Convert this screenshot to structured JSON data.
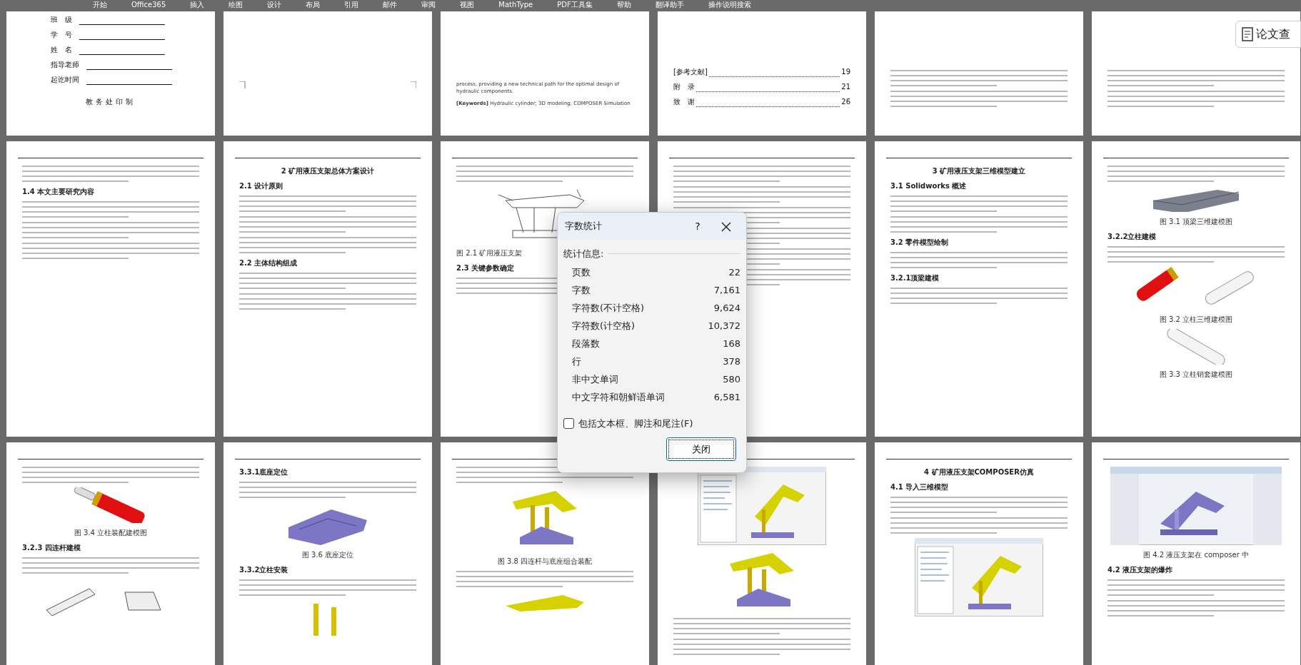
{
  "ribbon": {
    "tabs": [
      "开始",
      "Office365",
      "插入",
      "绘图",
      "设计",
      "布局",
      "引用",
      "邮件",
      "审阅",
      "视图",
      "MathType",
      "PDF工具集",
      "帮助",
      "翻译助手"
    ],
    "search": "操作说明搜索"
  },
  "side_button": {
    "label": "论文查"
  },
  "pages": [
    {
      "blocks": [
        {
          "kind": "field",
          "text": "班　级"
        },
        {
          "kind": "field",
          "text": "学　号"
        },
        {
          "kind": "field",
          "text": "姓　名"
        },
        {
          "kind": "field",
          "text": "指导老师"
        },
        {
          "kind": "field",
          "text": "起讫时间"
        },
        {
          "kind": "note",
          "text": "教务处印制"
        }
      ]
    },
    {
      "blocks": [
        {
          "kind": "corner-marks"
        }
      ]
    },
    {
      "blocks": [
        {
          "kind": "english",
          "text": "process, providing a new technical path for the optimal design of hydraulic components."
        },
        {
          "kind": "english",
          "text": "**[Keywords]** Hydraulic cylinder; 3D modeling; COMPOSER Simulation"
        }
      ]
    },
    {
      "blocks": [
        {
          "kind": "toc",
          "text": "[参考文献]",
          "page": "19"
        },
        {
          "kind": "toc",
          "text": "附　录",
          "page": "21"
        },
        {
          "kind": "toc",
          "text": "致　谢",
          "page": "26"
        }
      ]
    },
    {
      "blocks": [
        {
          "kind": "lines"
        },
        {
          "kind": "lines"
        }
      ]
    },
    {
      "blocks": [
        {
          "kind": "lines"
        },
        {
          "kind": "lines"
        }
      ]
    },
    {
      "blocks": [
        {
          "kind": "lines"
        },
        {
          "kind": "heading",
          "text": "1.4 本文主要研究内容"
        },
        {
          "kind": "lines"
        },
        {
          "kind": "lines"
        },
        {
          "kind": "lines"
        }
      ]
    },
    {
      "blocks": [
        {
          "kind": "title",
          "text": "2 矿用液压支架总体方案设计"
        },
        {
          "kind": "heading",
          "text": "2.1 设计原则"
        },
        {
          "kind": "lines"
        },
        {
          "kind": "lines"
        },
        {
          "kind": "lines"
        },
        {
          "kind": "heading",
          "text": "2.2 主体结构组成"
        },
        {
          "kind": "lines"
        },
        {
          "kind": "lines"
        }
      ]
    },
    {
      "blocks": [
        {
          "kind": "lines"
        },
        {
          "kind": "frame"
        },
        {
          "kind": "caption-left",
          "text": "图 2.1 矿用液压支架"
        },
        {
          "kind": "heading",
          "text": "2.3 关键参数确定"
        },
        {
          "kind": "lines"
        }
      ]
    },
    {
      "blocks": [
        {
          "kind": "lines"
        },
        {
          "kind": "lines"
        },
        {
          "kind": "lines"
        },
        {
          "kind": "lines"
        },
        {
          "kind": "lines"
        },
        {
          "kind": "lines"
        }
      ]
    },
    {
      "blocks": [
        {
          "kind": "title",
          "text": "3 矿用液压支架三维模型建立"
        },
        {
          "kind": "heading",
          "text": "3.1 Solidworks 概述"
        },
        {
          "kind": "lines"
        },
        {
          "kind": "lines"
        },
        {
          "kind": "heading",
          "text": "3.2 零件模型绘制"
        },
        {
          "kind": "lines"
        },
        {
          "kind": "heading",
          "text": "3.2.1顶梁建模"
        },
        {
          "kind": "lines"
        }
      ]
    },
    {
      "blocks": [
        {
          "kind": "lines"
        },
        {
          "kind": "plate"
        },
        {
          "kind": "caption",
          "text": "图 3.1 顶梁三维建模图"
        },
        {
          "kind": "heading",
          "text": "3.2.2立柱建模"
        },
        {
          "kind": "lines"
        },
        {
          "kind": "cylinders"
        },
        {
          "kind": "caption",
          "text": "图 3.2 立柱三维建模图"
        },
        {
          "kind": "pin"
        },
        {
          "kind": "caption",
          "text": "图 3.3 立柱销套建模图"
        }
      ]
    },
    {
      "blocks": [
        {
          "kind": "lines"
        },
        {
          "kind": "redcylinder"
        },
        {
          "kind": "caption",
          "text": "图 3.4 立柱装配建模图"
        },
        {
          "kind": "heading",
          "text": "3.2.3 四连杆建模"
        },
        {
          "kind": "lines"
        },
        {
          "kind": "linkage"
        }
      ]
    },
    {
      "blocks": [
        {
          "kind": "heading",
          "text": "3.3.1底座定位"
        },
        {
          "kind": "lines"
        },
        {
          "kind": "base"
        },
        {
          "kind": "caption",
          "text": "图 3.6 底座定位"
        },
        {
          "kind": "heading",
          "text": "3.3.2立柱安装"
        },
        {
          "kind": "lines"
        },
        {
          "kind": "posts"
        }
      ]
    },
    {
      "blocks": [
        {
          "kind": "lines"
        },
        {
          "kind": "support"
        },
        {
          "kind": "caption",
          "text": "图 3.8 四连杆与底座组合装配"
        },
        {
          "kind": "lines"
        },
        {
          "kind": "canopy"
        }
      ]
    },
    {
      "blocks": [
        {
          "kind": "screenshot"
        },
        {
          "kind": "support"
        },
        {
          "kind": "lines"
        },
        {
          "kind": "lines"
        }
      ]
    },
    {
      "blocks": [
        {
          "kind": "title",
          "text": "4 矿用液压支架COMPOSER仿真"
        },
        {
          "kind": "heading",
          "text": "4.1 导入三维模型"
        },
        {
          "kind": "lines"
        },
        {
          "kind": "lines"
        },
        {
          "kind": "screenshot"
        }
      ]
    },
    {
      "blocks": [
        {
          "kind": "viewer"
        },
        {
          "kind": "caption",
          "text": "图 4.2 液压支架在 composer 中"
        },
        {
          "kind": "heading",
          "text": "4.2 液压支架的爆炸"
        },
        {
          "kind": "lines"
        },
        {
          "kind": "lines"
        }
      ]
    }
  ],
  "dialog": {
    "title": "字数统计",
    "help": "?",
    "section": "统计信息:",
    "stats": [
      {
        "label": "页数",
        "value": "22"
      },
      {
        "label": "字数",
        "value": "7,161"
      },
      {
        "label": "字符数(不计空格)",
        "value": "9,624"
      },
      {
        "label": "字符数(计空格)",
        "value": "10,372"
      },
      {
        "label": "段落数",
        "value": "168"
      },
      {
        "label": "行",
        "value": "378"
      },
      {
        "label": "非中文单词",
        "value": "580"
      },
      {
        "label": "中文字符和朝鲜语单词",
        "value": "6,581"
      }
    ],
    "include_notes": {
      "label": "包括文本框、脚注和尾注(F)",
      "checked": false
    },
    "close": "关闭"
  }
}
